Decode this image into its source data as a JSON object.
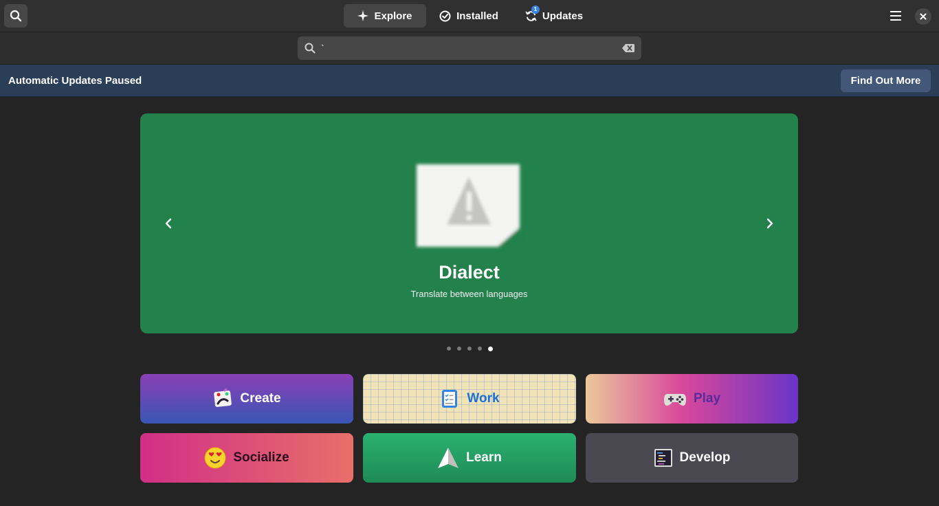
{
  "colors": {
    "carousel_bg": "#23814c",
    "accent": "#3584e4",
    "banner_bg": "#2b3e57"
  },
  "header": {
    "tabs": [
      {
        "label": "Explore",
        "icon": "explore-icon",
        "active": true
      },
      {
        "label": "Installed",
        "icon": "installed-check-icon",
        "active": false
      },
      {
        "label": "Updates",
        "icon": "updates-icon",
        "active": false,
        "badge": "1"
      }
    ]
  },
  "search": {
    "value": "`",
    "placeholder": ""
  },
  "banner": {
    "title": "Automatic Updates Paused",
    "button_label": "Find Out More"
  },
  "carousel": {
    "app_name": "Dialect",
    "app_summary": "Translate between languages",
    "icon": "missing-image-icon",
    "page_count": 5,
    "active_page": 5
  },
  "categories": [
    {
      "label": "Create",
      "icon": "create-palette-icon"
    },
    {
      "label": "Work",
      "icon": "work-checklist-icon"
    },
    {
      "label": "Play",
      "icon": "gamepad-icon"
    },
    {
      "label": "Socialize",
      "icon": "heart-eyes-emoji-icon"
    },
    {
      "label": "Learn",
      "icon": "paper-plane-icon"
    },
    {
      "label": "Develop",
      "icon": "code-editor-icon"
    }
  ]
}
